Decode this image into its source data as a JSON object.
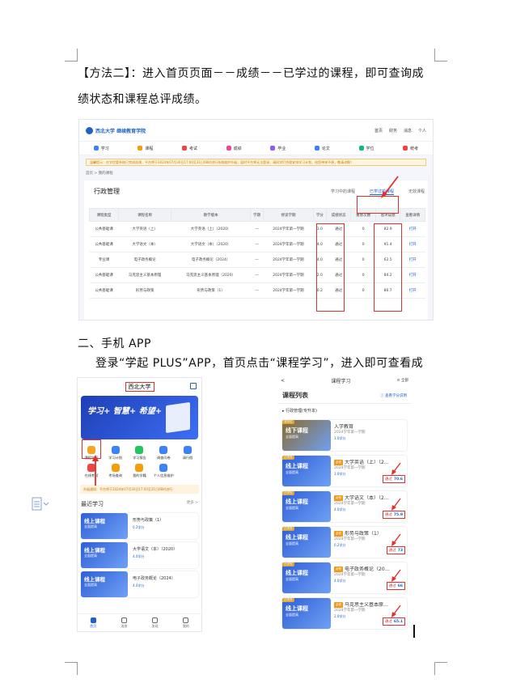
{
  "doc": {
    "para1": "【方法二】：进入首页页面－－成绩－－已学过的课程，即可查询成绩状态和课程总评成绩。",
    "section_heading": "二、手机 APP",
    "para2": "登录“学起 PLUS”APP，首页点击“课程学习”，进入即可查看成绩。"
  },
  "web": {
    "top_links": [
      "首页",
      "财务",
      "消息",
      "个人"
    ],
    "nav": [
      {
        "label": "学习",
        "color": "#3b82f6"
      },
      {
        "label": "课程",
        "color": "#f59e0b"
      },
      {
        "label": "考试",
        "color": "#ef4444"
      },
      {
        "label": "成绩",
        "color": "#ec4899"
      },
      {
        "label": "毕业",
        "color": "#8b5cf6"
      },
      {
        "label": "论文",
        "color": "#3b82f6"
      },
      {
        "label": "学位",
        "color": "#10b981"
      },
      {
        "label": "统考",
        "color": "#ef4444"
      }
    ],
    "notice": "温馨提示：在学信管系统已完成选课，平台将于2024年07月30日17:00至31日08时进行系统维护升级，届时平台将无法登录，请同学们合理安排学习计划，给您带来不便，敬请谅解！",
    "breadcrumb": "首页 > 我的课程",
    "panel_title": "行政管理",
    "tabs": [
      "学习中的课程",
      "已学过的课程",
      "无效课程"
    ],
    "table_headers": [
      "课程类型",
      "课程名称",
      "教学版本",
      "学期",
      "修读学期",
      "学分",
      "成绩状态",
      "重修次数",
      "总评成绩",
      "查看详情"
    ],
    "rows": [
      [
        "公共基础课",
        "大学英语（上）",
        "大学英语（上）（2020）",
        "—",
        "2024学年第一学期",
        "3.0",
        "通过",
        "0",
        "82.9",
        "打开"
      ],
      [
        "公共基础课",
        "大学语文（本）",
        "大学语文（本）（2020）",
        "—",
        "2024学年第一学期",
        "4.0",
        "通过",
        "0",
        "91.4",
        "打开"
      ],
      [
        "专业课",
        "电子政务概论",
        "电子政务概论（2024）",
        "—",
        "2024学年第一学期",
        "4.0",
        "通过",
        "0",
        "62.5",
        "打开"
      ],
      [
        "公共基础课",
        "马克思主义基本原理",
        "马克思主义基本原理（2020）",
        "—",
        "2024学年第一学期",
        "2.0",
        "通过",
        "0",
        "84.2",
        "打开"
      ],
      [
        "公共基础课",
        "形势与政策",
        "形势与政策（1）",
        "—",
        "2024学年第一学期",
        "0.2",
        "通过",
        "0",
        "86.7",
        "打开"
      ]
    ]
  },
  "app1": {
    "title": "西北大学",
    "banner": "学习+ 智慧+ 希望+",
    "grid": [
      {
        "label": "课程学习",
        "color": "#f5a623"
      },
      {
        "label": "学习计划",
        "color": "#3b82f6"
      },
      {
        "label": "学习报告",
        "color": "#22c55e"
      },
      {
        "label": "调查问卷",
        "color": "#3b82f6"
      },
      {
        "label": "请行假",
        "color": "#3b82f6"
      },
      {
        "label": "在线考试",
        "color": "#ef4444"
      },
      {
        "label": "考场查询",
        "color": "#f59e0b"
      },
      {
        "label": "我的学籍",
        "color": "#f59e0b"
      },
      {
        "label": "个人信息维护",
        "color": "#3b82f6"
      }
    ],
    "warn": "升级通知：平台将于2024年07月30日17:00至31日08时进行",
    "recent_title": "最近学习",
    "more": "更多 >",
    "recent": [
      {
        "thumb": "线上课程",
        "sub": "全面提高",
        "name": "形势与政策（1）",
        "credit": "0.2学分"
      },
      {
        "thumb": "线上课程",
        "sub": "全面提高",
        "name": "大学语文（本）（2020）",
        "credit": "4.0学分"
      },
      {
        "thumb": "线上课程",
        "sub": "全面提高",
        "name": "电子政务概论（2024）",
        "credit": "4.0学分"
      }
    ],
    "tabbar": [
      "首页",
      "消息",
      "发现",
      "我的"
    ]
  },
  "app2": {
    "back": "<",
    "title": "课程学习",
    "filter": "全部",
    "list_title": "课程列表",
    "explain": "查看学分说明",
    "group": "行政管理(专升本)",
    "courses": [
      {
        "tag": "非学位",
        "thumb": "线下课程",
        "sub": "全面提高",
        "req": "",
        "name": "入学教育",
        "term": "2024学年第一学期",
        "credit": "1.0学分",
        "status": "",
        "score": "",
        "color": "#8a6a2a"
      },
      {
        "tag": "已学完",
        "thumb": "线上课程",
        "sub": "全面提高",
        "req": "必修",
        "name": "大学英语（上）（2…",
        "term": "2024学年第一学期",
        "credit": "3.0学分",
        "status": "通过",
        "score": "70.6",
        "color": "#2e5fd6"
      },
      {
        "tag": "已学完",
        "thumb": "线上课程",
        "sub": "全面提高",
        "req": "必修",
        "name": "大学语文（本）（2…",
        "term": "2024学年第一学期",
        "credit": "4.0学分",
        "status": "通过",
        "score": "75.9",
        "color": "#2e5fd6"
      },
      {
        "tag": "已学完",
        "thumb": "线上课程",
        "sub": "全面提高",
        "req": "必修",
        "name": "形势与政策（1）",
        "term": "2024学年第一学期",
        "credit": "0.2学分",
        "status": "通过",
        "score": "73",
        "color": "#2e5fd6"
      },
      {
        "tag": "已学完",
        "thumb": "线上课程",
        "sub": "全面提高",
        "req": "必修",
        "name": "电子政务概论（20…",
        "term": "2024学年第一学期",
        "credit": "4.0学分",
        "status": "通过",
        "score": "66",
        "color": "#2e5fd6"
      },
      {
        "tag": "已学完",
        "thumb": "线上课程",
        "sub": "全面提高",
        "req": "必修",
        "name": "马克思主义基本原…",
        "term": "2024学年第一学期",
        "credit": "2.0学分",
        "status": "通过",
        "score": "65.1",
        "color": "#2e5fd6"
      }
    ]
  }
}
